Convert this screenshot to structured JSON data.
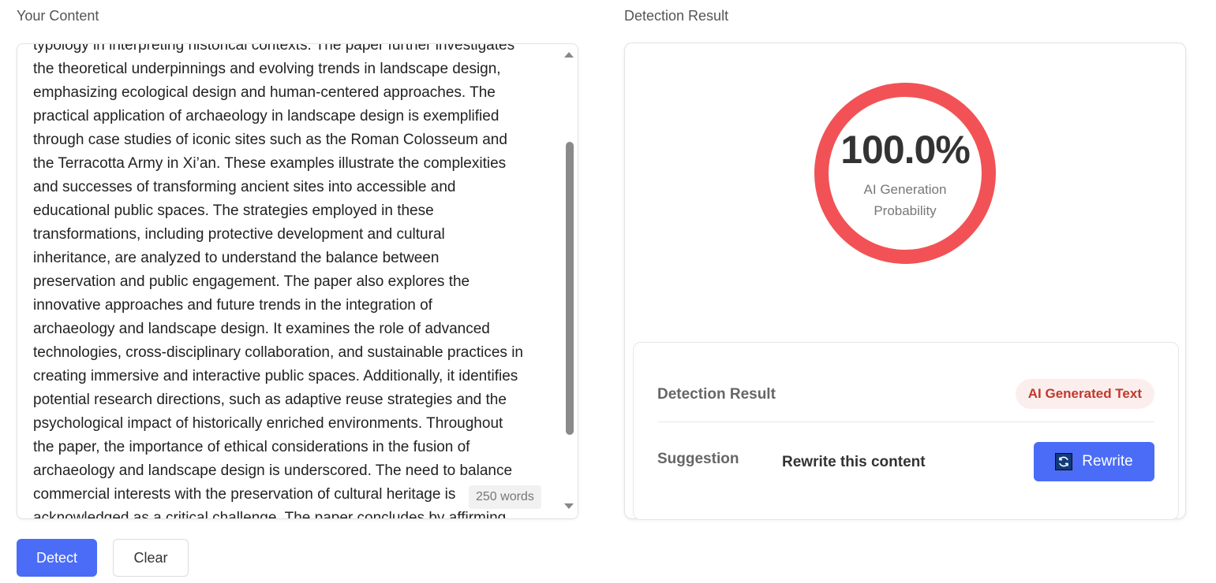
{
  "left": {
    "title": "Your Content",
    "text_lines": [
      "typology in interpreting historical contexts. The paper further investigates",
      "the theoretical underpinnings and evolving trends in landscape design,",
      "emphasizing ecological design and human-centered approaches. The",
      "practical application of archaeology in landscape design is exemplified",
      "through case studies of iconic sites such as the Roman Colosseum and",
      "the Terracotta Army in Xi’an. These examples illustrate the complexities",
      "and successes of transforming ancient sites into accessible and",
      "educational public spaces. The strategies employed in these",
      "transformations, including protective development and cultural",
      "inheritance, are analyzed to understand the balance between",
      "preservation and public engagement. The paper also explores the",
      "innovative approaches and future trends in the integration of",
      "archaeology and landscape design. It examines the role of advanced",
      "technologies, cross-disciplinary collaboration, and sustainable practices in",
      "creating immersive and interactive public spaces. Additionally, it identifies",
      "potential research directions, such as adaptive reuse strategies and the",
      "psychological impact of historically enriched environments. Throughout",
      "the paper, the importance of ethical considerations in the fusion of",
      "archaeology and landscape design is underscored. The need to balance",
      "commercial interests with the preservation of cultural heritage is",
      "acknowledged as a critical challenge. The paper concludes by affirming"
    ],
    "word_count": "250 words",
    "buttons": {
      "detect": "Detect",
      "clear": "Clear"
    }
  },
  "right": {
    "title": "Detection Result",
    "gauge": {
      "value": "100.0%",
      "fraction": 1.0,
      "caption_line1": "AI Generation",
      "caption_line2": "Probability",
      "color": "#f25256"
    },
    "result_label": "Detection Result",
    "result_badge": "AI Generated Text",
    "suggestion_label": "Suggestion",
    "suggestion_text": "Rewrite this content",
    "rewrite_button": "Rewrite"
  },
  "colors": {
    "primary": "#4a6cf7",
    "danger": "#f25256",
    "badge_bg": "#fdeeee",
    "badge_text": "#c0392b"
  }
}
